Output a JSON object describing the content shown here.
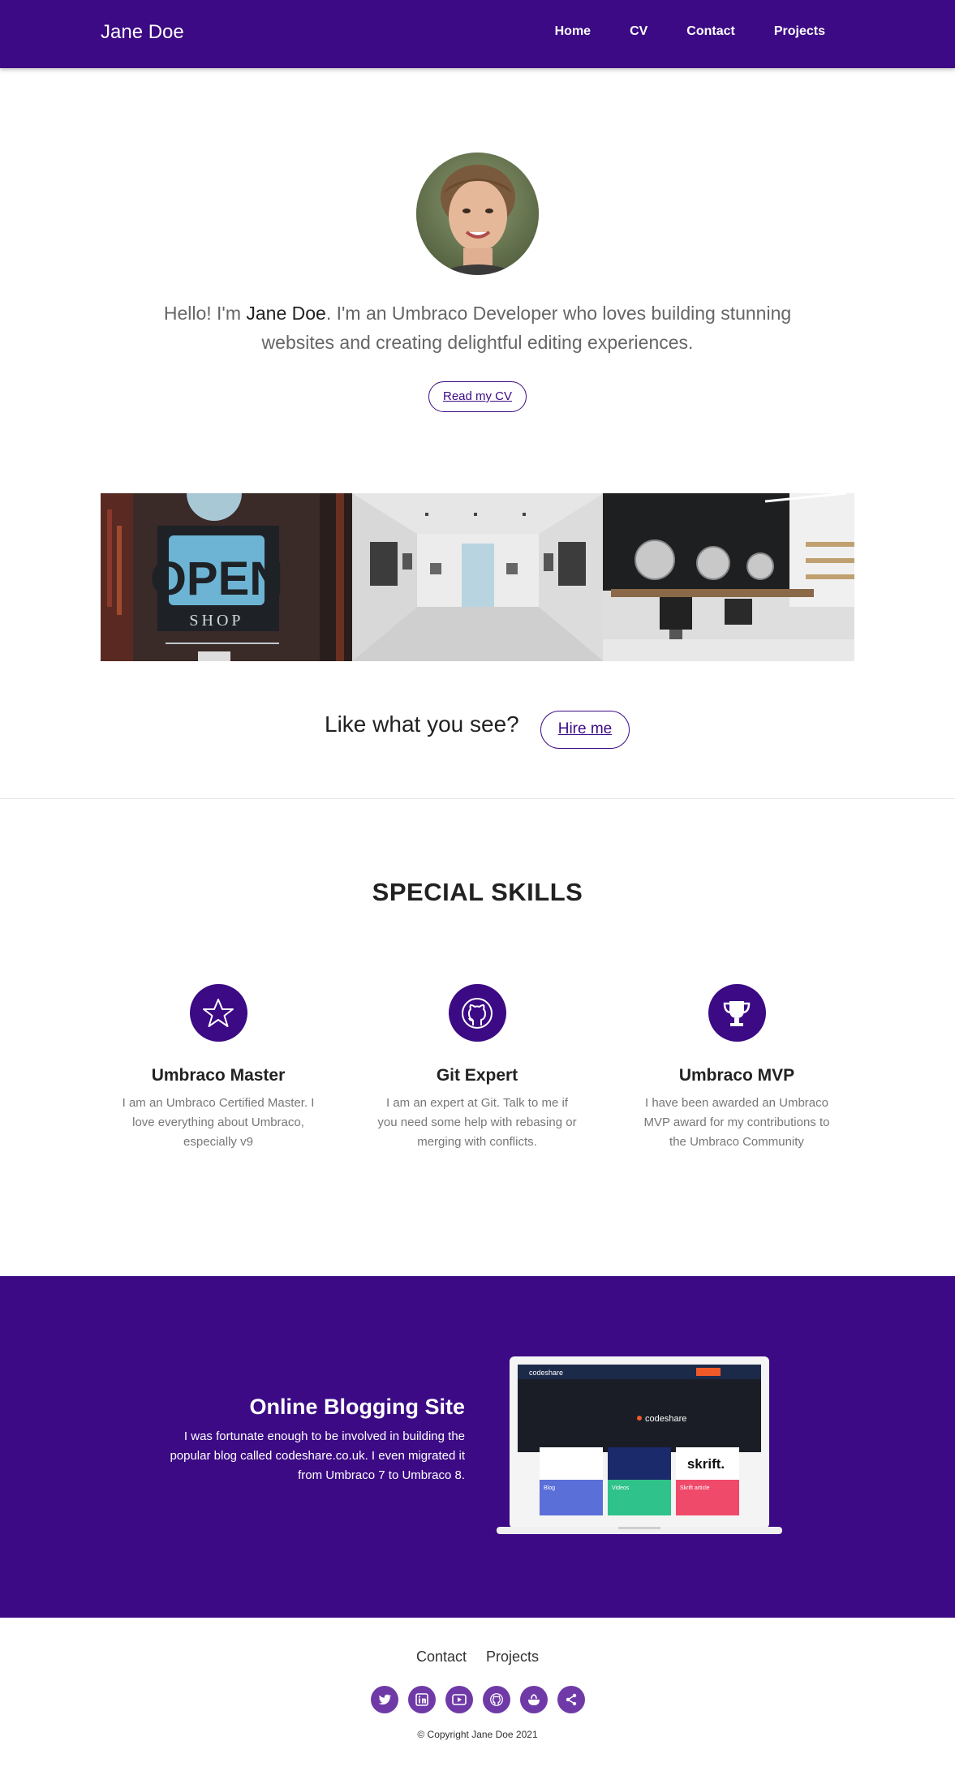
{
  "nav": {
    "brand": "Jane Doe",
    "links": [
      "Home",
      "CV",
      "Contact",
      "Projects"
    ]
  },
  "hero": {
    "greeting": "Hello! I'm ",
    "name": "Jane Doe",
    "tagline": ". I'm an Umbraco Developer who loves building stunning websites and creating delightful editing experiences.",
    "cv_button": "Read my CV"
  },
  "gallery": {
    "shop_sign": "OPEN",
    "shop_sub": "SHOP"
  },
  "cta": {
    "text": "Like what you see?",
    "button": "Hire me"
  },
  "skills": {
    "title": "SPECIAL SKILLS",
    "items": [
      {
        "icon": "star-icon",
        "name": "Umbraco Master",
        "desc": "I am an Umbraco Certified Master. I love everything about Umbraco, especially v9"
      },
      {
        "icon": "github-icon",
        "name": "Git Expert",
        "desc": "I am an expert at Git. Talk to me if you need some help with rebasing or merging with conflicts."
      },
      {
        "icon": "trophy-icon",
        "name": "Umbraco MVP",
        "desc": "I have been awarded an Umbraco MVP award for my contributions to the Umbraco Community"
      }
    ]
  },
  "feature": {
    "title": "Online Blogging Site",
    "text": "I was fortunate enough to be involved in building the popular blog called codeshare.co.uk. I even migrated it from Umbraco 7 to Umbraco 8.",
    "screen": {
      "logo": "codeshare",
      "card1": "Blog",
      "card2": "Videos",
      "card3": "Skrift article",
      "skrift": "skrift."
    }
  },
  "footer": {
    "links": [
      "Contact",
      "Projects"
    ],
    "socials": [
      "twitter-icon",
      "linkedin-icon",
      "youtube-icon",
      "github-icon",
      "umbraco-icon",
      "share-icon"
    ],
    "copyright": "© Copyright Jane Doe 2021"
  },
  "colors": {
    "brand": "#3b0a84",
    "social": "#6f3aa7"
  }
}
